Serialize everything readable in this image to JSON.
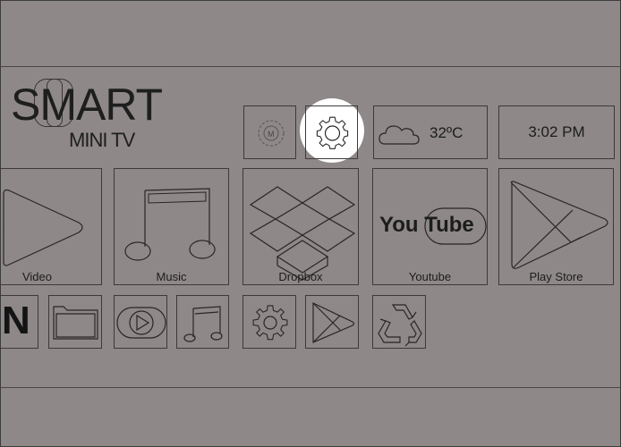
{
  "logo": {
    "main": "SMART",
    "sub": "MINI TV"
  },
  "status": {
    "temperature": "32ºC",
    "time": "3:02 PM"
  },
  "apps": [
    {
      "label": "Video",
      "icon": "play-triangle-icon"
    },
    {
      "label": "Music",
      "icon": "music-note-icon"
    },
    {
      "label": "Dropbox",
      "icon": "dropbox-icon"
    },
    {
      "label": "Youtube",
      "icon": "youtube-icon"
    },
    {
      "label": "Play Store",
      "icon": "play-store-icon"
    }
  ],
  "youtube": {
    "logo_you": "You",
    "logo_tube": "Tube"
  },
  "shortcut_row": {
    "partial_letter": "N"
  },
  "icons": {
    "top_row": [
      "globe-icon",
      "settings-gear-icon",
      "cloud-icon"
    ],
    "bottom_row": [
      "folder-icon",
      "video-play-icon",
      "music-note-icon",
      "settings-gear-icon",
      "play-store-icon",
      "recycle-icon"
    ]
  },
  "colors": {
    "background": "#8e8888",
    "line": "#3e3a3a",
    "focus_highlight": "#ffffff"
  }
}
